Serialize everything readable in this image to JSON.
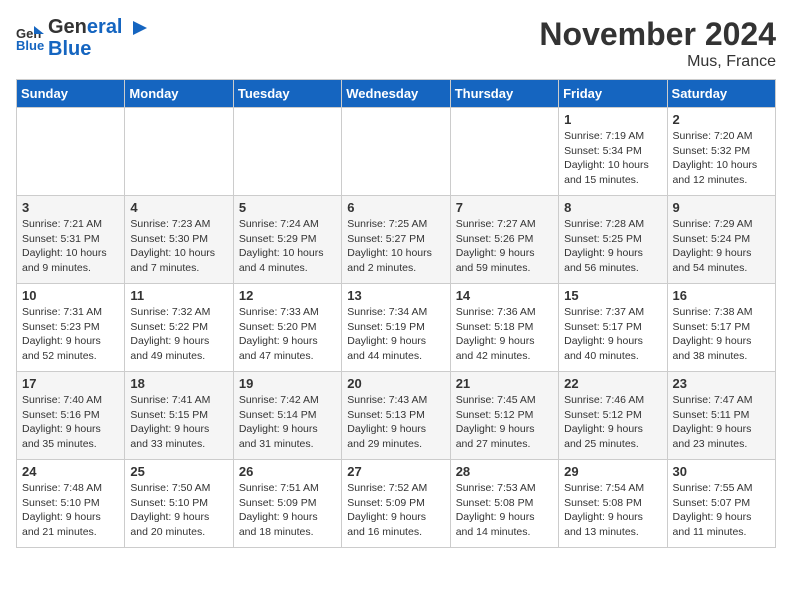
{
  "logo": {
    "line1": "General",
    "line2": "Blue"
  },
  "title": "November 2024",
  "location": "Mus, France",
  "weekdays": [
    "Sunday",
    "Monday",
    "Tuesday",
    "Wednesday",
    "Thursday",
    "Friday",
    "Saturday"
  ],
  "weeks": [
    [
      {
        "day": "",
        "info": ""
      },
      {
        "day": "",
        "info": ""
      },
      {
        "day": "",
        "info": ""
      },
      {
        "day": "",
        "info": ""
      },
      {
        "day": "",
        "info": ""
      },
      {
        "day": "1",
        "info": "Sunrise: 7:19 AM\nSunset: 5:34 PM\nDaylight: 10 hours and 15 minutes."
      },
      {
        "day": "2",
        "info": "Sunrise: 7:20 AM\nSunset: 5:32 PM\nDaylight: 10 hours and 12 minutes."
      }
    ],
    [
      {
        "day": "3",
        "info": "Sunrise: 7:21 AM\nSunset: 5:31 PM\nDaylight: 10 hours and 9 minutes."
      },
      {
        "day": "4",
        "info": "Sunrise: 7:23 AM\nSunset: 5:30 PM\nDaylight: 10 hours and 7 minutes."
      },
      {
        "day": "5",
        "info": "Sunrise: 7:24 AM\nSunset: 5:29 PM\nDaylight: 10 hours and 4 minutes."
      },
      {
        "day": "6",
        "info": "Sunrise: 7:25 AM\nSunset: 5:27 PM\nDaylight: 10 hours and 2 minutes."
      },
      {
        "day": "7",
        "info": "Sunrise: 7:27 AM\nSunset: 5:26 PM\nDaylight: 9 hours and 59 minutes."
      },
      {
        "day": "8",
        "info": "Sunrise: 7:28 AM\nSunset: 5:25 PM\nDaylight: 9 hours and 56 minutes."
      },
      {
        "day": "9",
        "info": "Sunrise: 7:29 AM\nSunset: 5:24 PM\nDaylight: 9 hours and 54 minutes."
      }
    ],
    [
      {
        "day": "10",
        "info": "Sunrise: 7:31 AM\nSunset: 5:23 PM\nDaylight: 9 hours and 52 minutes."
      },
      {
        "day": "11",
        "info": "Sunrise: 7:32 AM\nSunset: 5:22 PM\nDaylight: 9 hours and 49 minutes."
      },
      {
        "day": "12",
        "info": "Sunrise: 7:33 AM\nSunset: 5:20 PM\nDaylight: 9 hours and 47 minutes."
      },
      {
        "day": "13",
        "info": "Sunrise: 7:34 AM\nSunset: 5:19 PM\nDaylight: 9 hours and 44 minutes."
      },
      {
        "day": "14",
        "info": "Sunrise: 7:36 AM\nSunset: 5:18 PM\nDaylight: 9 hours and 42 minutes."
      },
      {
        "day": "15",
        "info": "Sunrise: 7:37 AM\nSunset: 5:17 PM\nDaylight: 9 hours and 40 minutes."
      },
      {
        "day": "16",
        "info": "Sunrise: 7:38 AM\nSunset: 5:17 PM\nDaylight: 9 hours and 38 minutes."
      }
    ],
    [
      {
        "day": "17",
        "info": "Sunrise: 7:40 AM\nSunset: 5:16 PM\nDaylight: 9 hours and 35 minutes."
      },
      {
        "day": "18",
        "info": "Sunrise: 7:41 AM\nSunset: 5:15 PM\nDaylight: 9 hours and 33 minutes."
      },
      {
        "day": "19",
        "info": "Sunrise: 7:42 AM\nSunset: 5:14 PM\nDaylight: 9 hours and 31 minutes."
      },
      {
        "day": "20",
        "info": "Sunrise: 7:43 AM\nSunset: 5:13 PM\nDaylight: 9 hours and 29 minutes."
      },
      {
        "day": "21",
        "info": "Sunrise: 7:45 AM\nSunset: 5:12 PM\nDaylight: 9 hours and 27 minutes."
      },
      {
        "day": "22",
        "info": "Sunrise: 7:46 AM\nSunset: 5:12 PM\nDaylight: 9 hours and 25 minutes."
      },
      {
        "day": "23",
        "info": "Sunrise: 7:47 AM\nSunset: 5:11 PM\nDaylight: 9 hours and 23 minutes."
      }
    ],
    [
      {
        "day": "24",
        "info": "Sunrise: 7:48 AM\nSunset: 5:10 PM\nDaylight: 9 hours and 21 minutes."
      },
      {
        "day": "25",
        "info": "Sunrise: 7:50 AM\nSunset: 5:10 PM\nDaylight: 9 hours and 20 minutes."
      },
      {
        "day": "26",
        "info": "Sunrise: 7:51 AM\nSunset: 5:09 PM\nDaylight: 9 hours and 18 minutes."
      },
      {
        "day": "27",
        "info": "Sunrise: 7:52 AM\nSunset: 5:09 PM\nDaylight: 9 hours and 16 minutes."
      },
      {
        "day": "28",
        "info": "Sunrise: 7:53 AM\nSunset: 5:08 PM\nDaylight: 9 hours and 14 minutes."
      },
      {
        "day": "29",
        "info": "Sunrise: 7:54 AM\nSunset: 5:08 PM\nDaylight: 9 hours and 13 minutes."
      },
      {
        "day": "30",
        "info": "Sunrise: 7:55 AM\nSunset: 5:07 PM\nDaylight: 9 hours and 11 minutes."
      }
    ]
  ]
}
